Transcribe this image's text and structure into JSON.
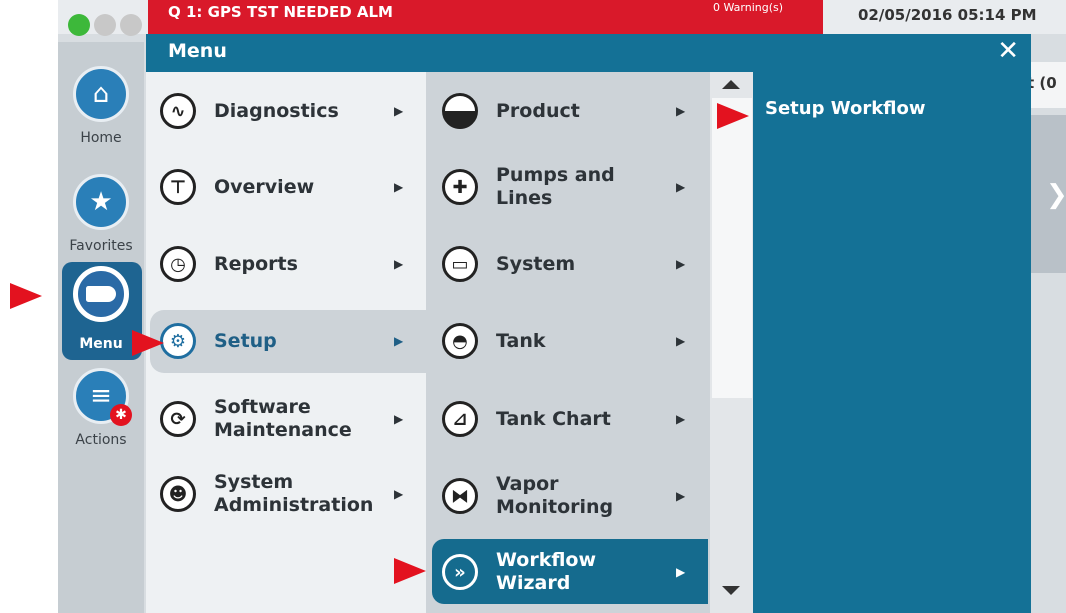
{
  "status": {
    "alarm_text": "Q 1: GPS TST NEEDED ALM",
    "warnings": "0 Warning(s)",
    "datetime": "02/05/2016 05:14 PM",
    "bg_fragment": "t (0"
  },
  "sidebar": {
    "items": [
      {
        "label": "Home"
      },
      {
        "label": "Favorites"
      },
      {
        "label": "Menu"
      },
      {
        "label": "Actions"
      }
    ]
  },
  "menu": {
    "title": "Menu",
    "col1": [
      {
        "label": "Diagnostics",
        "icon": "diagnostics-icon"
      },
      {
        "label": "Overview",
        "icon": "overview-icon"
      },
      {
        "label": "Reports",
        "icon": "reports-icon"
      },
      {
        "label": "Setup",
        "icon": "gear-icon"
      },
      {
        "label": "Software Maintenance",
        "icon": "sync-icon"
      },
      {
        "label": "System Administration",
        "icon": "admin-icon"
      }
    ],
    "col2": [
      {
        "label": "Product",
        "icon": "product-icon"
      },
      {
        "label": "Pumps and Lines",
        "icon": "pump-icon"
      },
      {
        "label": "System",
        "icon": "system-icon"
      },
      {
        "label": "Tank",
        "icon": "tank-icon"
      },
      {
        "label": "Tank Chart",
        "icon": "chart-icon"
      },
      {
        "label": "Vapor Monitoring",
        "icon": "vapor-icon"
      },
      {
        "label": "Workflow Wizard",
        "icon": "wizard-icon"
      }
    ],
    "col3": [
      {
        "label": "Setup Workflow"
      }
    ]
  },
  "colors": {
    "accent": "#147196",
    "alarm": "#d9192a",
    "pointer": "#e3121f"
  }
}
